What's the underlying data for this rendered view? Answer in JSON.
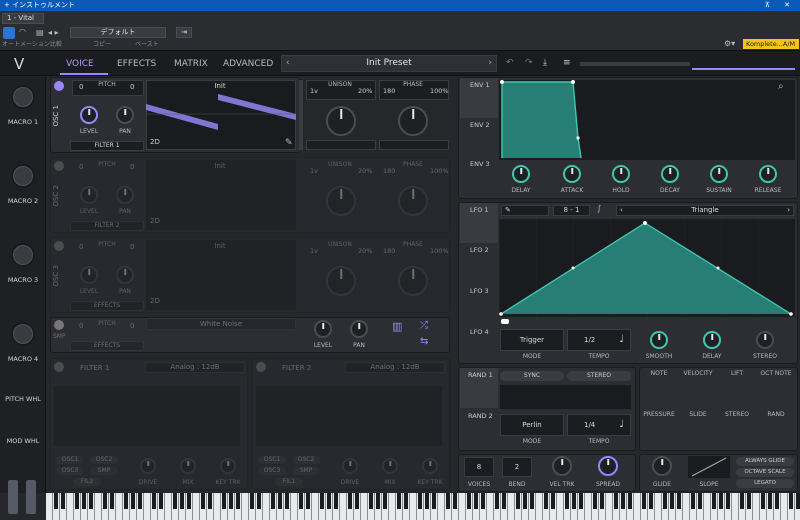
{
  "host": {
    "title": "インストゥルメント",
    "track": "1 - Vital",
    "preset_menu": "デフォルト",
    "labels": [
      "オートメーション",
      "比較",
      "コピー",
      "ペースト"
    ],
    "right_selector": "Komplete...A/M"
  },
  "tabs": [
    "VOICE",
    "EFFECTS",
    "MATRIX",
    "ADVANCED"
  ],
  "preset_name": "Init Preset",
  "macros": [
    "MACRO 1",
    "MACRO 2",
    "MACRO 3",
    "MACRO 4",
    "PITCH WHL",
    "MOD WHL"
  ],
  "osc": [
    {
      "label": "OSC 1",
      "wave": "Init",
      "pitch_left": "0",
      "pitch_right": "0",
      "filter": "FILTER 1",
      "level": "LEVEL",
      "pan": "PAN",
      "unison_voices": "1v",
      "unison_label": "UNISON",
      "unison_pct": "20%",
      "phase_val": "180",
      "phase_label": "PHASE",
      "phase_pct": "100%",
      "mode": "2D",
      "pitch_label": "PITCH"
    },
    {
      "label": "OSC 2",
      "wave": "Init",
      "pitch_left": "0",
      "pitch_right": "0",
      "filter": "FILTER 2",
      "level": "LEVEL",
      "pan": "PAN",
      "unison_voices": "1v",
      "unison_label": "UNISON",
      "unison_pct": "20%",
      "phase_val": "180",
      "phase_label": "PHASE",
      "phase_pct": "100%",
      "mode": "2D",
      "pitch_label": "PITCH"
    },
    {
      "label": "OSC 3",
      "wave": "Init",
      "pitch_left": "0",
      "pitch_right": "0",
      "filter": "EFFECTS",
      "level": "LEVEL",
      "pan": "PAN",
      "unison_voices": "1v",
      "unison_label": "UNISON",
      "unison_pct": "20%",
      "phase_val": "180",
      "phase_label": "PHASE",
      "phase_pct": "100%",
      "mode": "2D",
      "pitch_label": "PITCH"
    }
  ],
  "smp": {
    "label": "SMP",
    "noise": "White Noise",
    "filter": "EFFECTS",
    "level": "LEVEL",
    "pan": "PAN",
    "pitch_label": "PITCH",
    "pitch_left": "0",
    "pitch_right": "0"
  },
  "filters": [
    {
      "label": "FILTER 1",
      "model": "Analog : 12dB",
      "drive": "DRIVE",
      "mix": "MIX",
      "keytrk": "KEY TRK",
      "btns": [
        "OSC1",
        "OSC2",
        "OSC3",
        "SMP",
        "FIL2"
      ]
    },
    {
      "label": "FILTER 2",
      "model": "Analog : 12dB",
      "drive": "DRIVE",
      "mix": "MIX",
      "keytrk": "KEY TRK",
      "btns": [
        "OSC1",
        "OSC2",
        "OSC3",
        "SMP",
        "FIL1"
      ]
    }
  ],
  "env": {
    "tabs": [
      "ENV 1",
      "ENV 2",
      "ENV 3"
    ],
    "knobs": [
      "DELAY",
      "ATTACK",
      "HOLD",
      "DECAY",
      "SUSTAIN",
      "RELEASE"
    ]
  },
  "lfo": {
    "tabs": [
      "LFO 1",
      "LFO 2",
      "LFO 3",
      "LFO 4"
    ],
    "grid_x": "8",
    "grid_y": "1",
    "shape": "Triangle",
    "mode": "Trigger",
    "mode_label": "MODE",
    "tempo": "1/2",
    "tempo_label": "TEMPO",
    "smooth": "SMOOTH",
    "delay": "DELAY",
    "stereo": "STEREO"
  },
  "rand": {
    "tabs": [
      "RAND 1",
      "RAND 2"
    ],
    "sync": "SYNC",
    "stereo": "STEREO",
    "style": "Perlin",
    "mode_label": "MODE",
    "tempo": "1/4",
    "tempo_label": "TEMPO"
  },
  "modsrc": {
    "top": [
      "NOTE",
      "VELOCITY",
      "LIFT",
      "OCT NOTE"
    ],
    "bottom": [
      "PRESSURE",
      "SLIDE",
      "STEREO",
      "RAND"
    ]
  },
  "voice": {
    "voices": "8",
    "voices_label": "VOICES",
    "bend": "2",
    "bend_label": "BEND",
    "veltrk": "VEL TRK",
    "spread": "SPREAD",
    "glide": "GLIDE",
    "slope": "SLOPE",
    "always_glide": "ALWAYS GLIDE",
    "octave_scale": "OCTAVE SCALE",
    "legato": "LEGATO"
  },
  "colors": {
    "accent": "#9a86ff",
    "env": "#3fc7b2",
    "bg": "#26272b"
  }
}
